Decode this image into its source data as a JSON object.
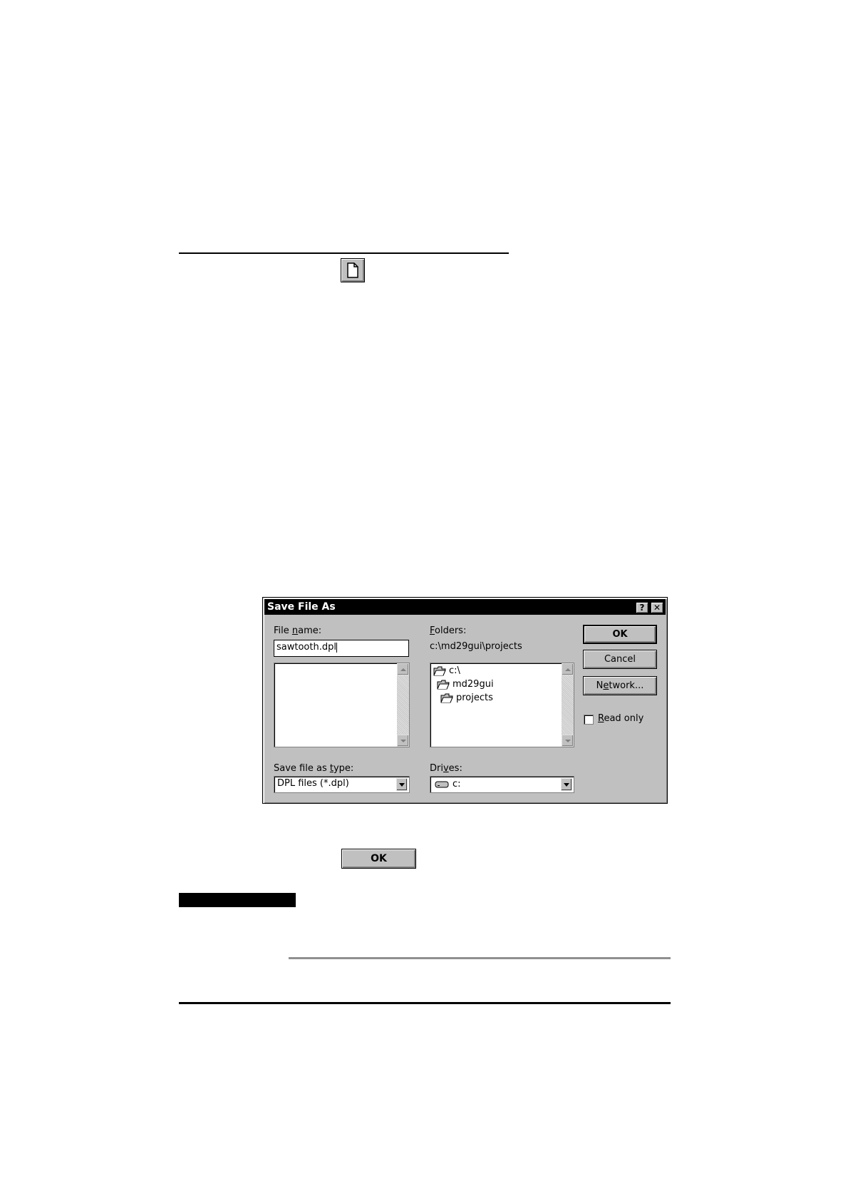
{
  "dialog": {
    "title": "Save File As",
    "help_button": "?",
    "close_button": "✕",
    "file_name_label_u": "n",
    "file_name_label_pre": "File ",
    "file_name_label_post": "ame:",
    "file_name_value": "sawtooth.dpl",
    "folders_label_u": "F",
    "folders_label_post": "olders:",
    "current_folder": "c:\\md29gui\\projects",
    "folders": [
      "c:\\",
      "md29gui",
      "projects"
    ],
    "save_type_label_pre": "Save file as ",
    "save_type_label_u": "t",
    "save_type_label_post": "ype:",
    "save_type_value": "DPL files (*.dpl)",
    "drives_label_pre": "Dri",
    "drives_label_u": "v",
    "drives_label_post": "es:",
    "drives_value": "c:",
    "ok_label": "OK",
    "cancel_label": "Cancel",
    "network_label_pre": "N",
    "network_label_u": "e",
    "network_label_post": "twork...",
    "read_only_label_u": "R",
    "read_only_label_post": "ead only",
    "read_only_checked": false
  },
  "standalone_ok_label": "OK",
  "icons": {
    "new_document": "new-document-icon",
    "folder_open": "folder-open-icon",
    "drive": "drive-icon"
  },
  "colors": {
    "dialog_face": "#c0c0c0",
    "title_bar": "#000000"
  }
}
